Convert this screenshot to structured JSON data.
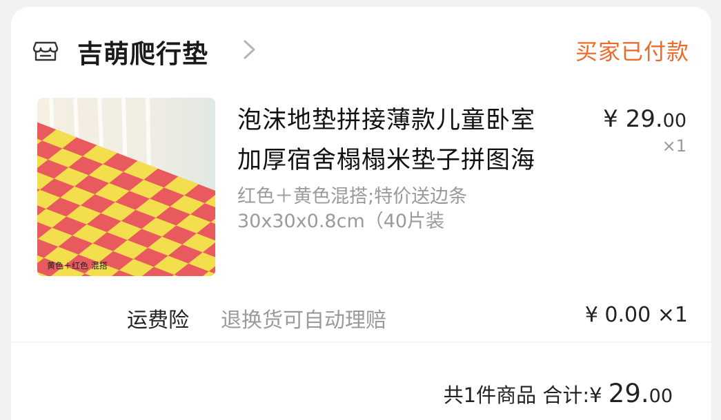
{
  "store": {
    "name": "吉萌爬行垫",
    "status": "买家已付款",
    "icon": "store-icon"
  },
  "item": {
    "title_line1": "泡沫地垫拼接薄款儿童卧室",
    "title_line2": "加厚宿舍榻榻米垫子拼图海",
    "price_int": "¥ 29.",
    "price_dec": "00",
    "quantity": "×1",
    "spec_line1": "红色＋黄色混搭;特价送边条",
    "spec_line2": "30x30x0.8cm（40片装",
    "image_caption": "黄色＋红色 混搭",
    "image_colors": {
      "red": "#e85a5e",
      "yellow": "#f3de4e",
      "wall": "#e9efe8",
      "curtain": "#f5f0e6"
    }
  },
  "insurance": {
    "label": "运费险",
    "desc": "退换货可自动理赔",
    "price": "¥ 0.00 ×1"
  },
  "summary": {
    "count_text": "共1件商品",
    "total_label": "合计:",
    "currency": "¥ ",
    "total_int": "29.",
    "total_dec": "00"
  },
  "colors": {
    "accent": "#ee6a2a",
    "muted": "#9a9a9a"
  }
}
